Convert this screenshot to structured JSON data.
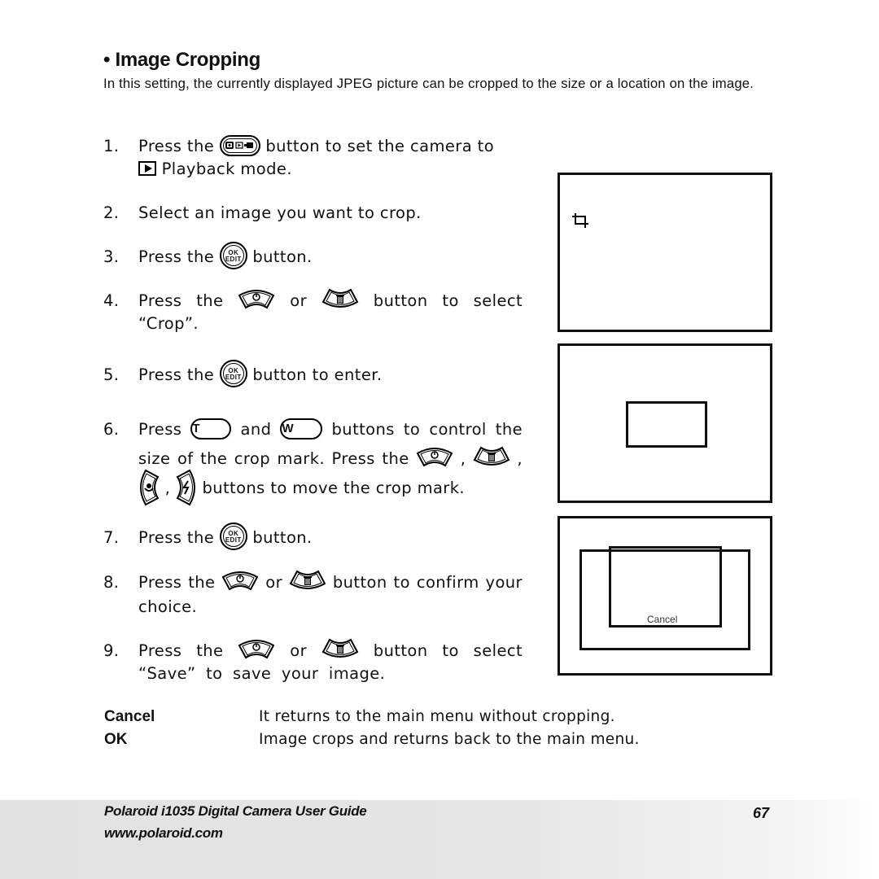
{
  "section": {
    "title": "• Image Cropping",
    "intro": "In this setting, the currently displayed JPEG picture can be cropped to the size or a location on the image."
  },
  "steps": [
    {
      "num": "1.",
      "parts": [
        "Press the",
        "button to set the camera to",
        "Playback mode."
      ]
    },
    {
      "num": "2.",
      "parts": [
        "Select an image you want to crop."
      ]
    },
    {
      "num": "3.",
      "parts": [
        "Press the",
        "button."
      ]
    },
    {
      "num": "4.",
      "parts": [
        "Press the",
        "or",
        "button to select “Crop”."
      ]
    },
    {
      "num": "5.",
      "parts": [
        "Press the",
        "button to enter."
      ]
    },
    {
      "num": "6.",
      "parts": [
        "Press",
        "and",
        "buttons to control the size of the crop mark. Press the",
        ",",
        ",",
        ",",
        "buttons to move the crop mark."
      ]
    },
    {
      "num": "7.",
      "parts": [
        "Press the",
        "button."
      ]
    },
    {
      "num": "8.",
      "parts": [
        "Press the",
        "or",
        "button to confirm your choice."
      ]
    },
    {
      "num": "9.",
      "parts": [
        "Press the",
        "or",
        "button to select “Save” to save your image."
      ]
    }
  ],
  "icons": {
    "ok_top": "OK",
    "ok_bottom": "EDIT",
    "tele": "T",
    "wide": "W"
  },
  "screens": {
    "cancel_label": "Cancel"
  },
  "definitions": [
    {
      "term": "Cancel",
      "desc": "It returns to the main menu without cropping."
    },
    {
      "term": "OK",
      "desc": "Image crops and returns back to the main menu."
    }
  ],
  "footer": {
    "title": "Polaroid i1035 Digital Camera User Guide",
    "url": "www.polaroid.com",
    "page": "67"
  }
}
